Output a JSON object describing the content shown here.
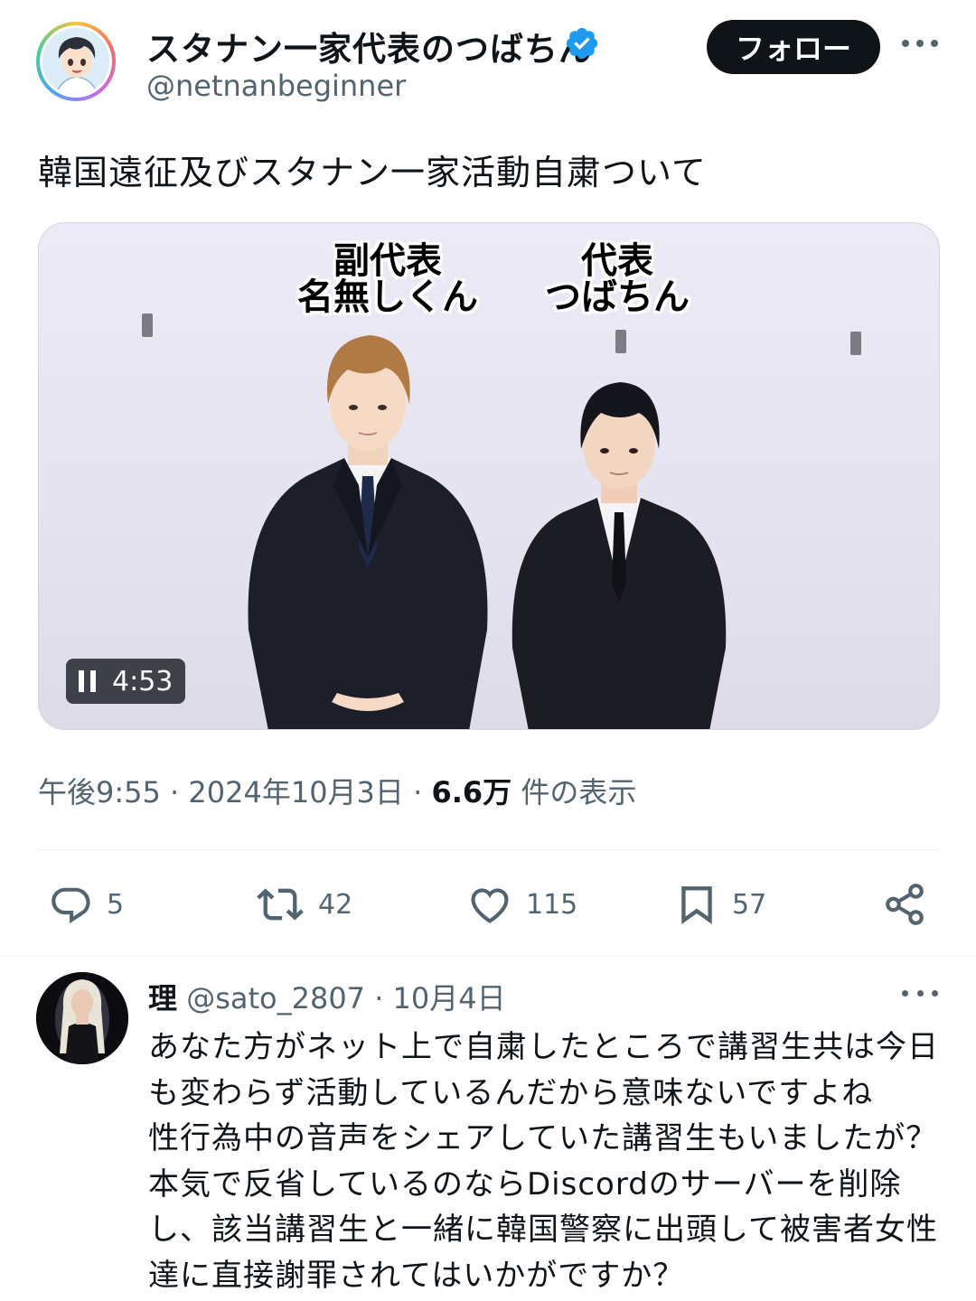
{
  "tweet": {
    "author": {
      "display_name": "スタナン一家代表のつばちん",
      "handle": "@netnanbeginner",
      "verified": true
    },
    "follow_label": "フォロー",
    "text": "韓国遠征及びスタナン一家活動自粛ついて",
    "media": {
      "caption_left_line1": "副代表",
      "caption_left_line2": "名無しくん",
      "caption_right_line1": "代表",
      "caption_right_line2": "つばちん",
      "duration": "4:53"
    },
    "meta": {
      "time": "午後9:55",
      "separator1": "·",
      "date": "2024年10月3日",
      "separator2": "·",
      "views_count": "6.6万",
      "views_label": "件の表示"
    },
    "actions": {
      "reply_count": "5",
      "retweet_count": "42",
      "like_count": "115",
      "bookmark_count": "57"
    }
  },
  "reply": {
    "name": "理",
    "handle": "@sato_2807",
    "separator": "·",
    "date": "10月4日",
    "lines": [
      "あなた方がネット上で自粛したところで講習生共は今日",
      "も変わらず活動しているんだから意味ないですよね",
      "性行為中の音声をシェアしていた講習生もいましたが？",
      "本気で反省しているのならDiscordのサーバーを削除",
      "し、該当講習生と一緒に韓国警察に出頭して被害者女性",
      "達に直接謝罪されてはいかがですか？"
    ]
  },
  "colors": {
    "accent_blue": "#1d9bf0",
    "text_primary": "#0f1419",
    "text_secondary": "#536471"
  },
  "icons": [
    "verified-badge-icon",
    "more-icon",
    "pause-icon",
    "reply-icon",
    "retweet-icon",
    "like-icon",
    "bookmark-icon",
    "share-icon"
  ]
}
